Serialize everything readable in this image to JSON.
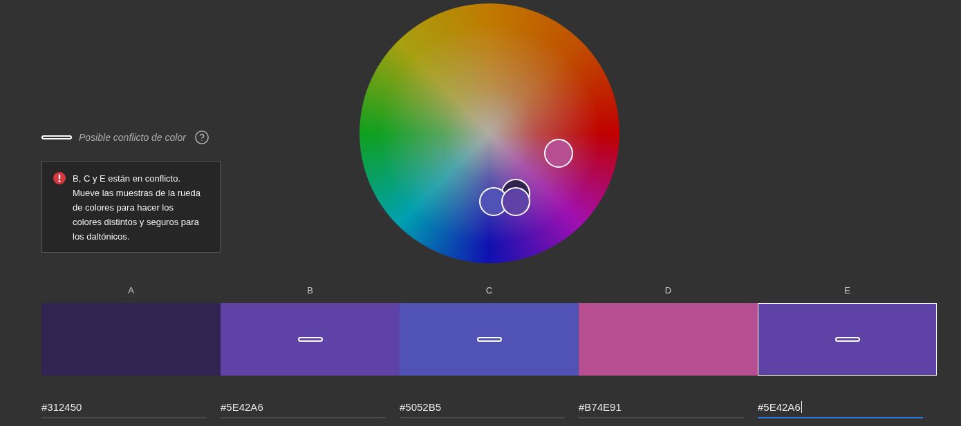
{
  "legend": {
    "label": "Posible conflicto de color"
  },
  "alert": {
    "message": "B, C y E están en conflicto. Mueve las muestras de la rueda de colores para hacer los colores distintos y seguros para los daltónicos."
  },
  "swatches": [
    {
      "label": "A",
      "hex": "#312450",
      "conflict": false,
      "selected": false
    },
    {
      "label": "B",
      "hex": "#5E42A6",
      "conflict": true,
      "selected": false
    },
    {
      "label": "C",
      "hex": "#5052B5",
      "conflict": true,
      "selected": false
    },
    {
      "label": "D",
      "hex": "#B74E91",
      "conflict": false,
      "selected": false
    },
    {
      "label": "E",
      "hex": "#5E42A6",
      "conflict": true,
      "selected": true
    }
  ]
}
